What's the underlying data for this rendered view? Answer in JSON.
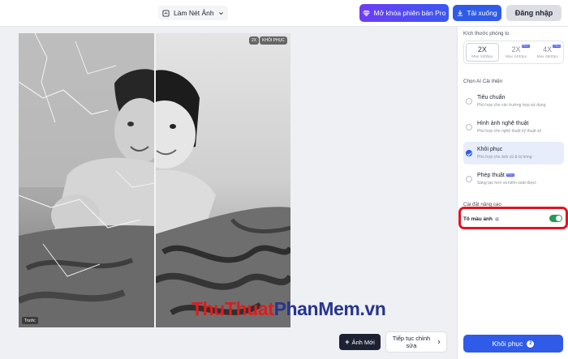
{
  "topbar": {
    "tool_label": "Làm Nét Ảnh",
    "pro_button": "Mở khóa phiên bản Pro",
    "download_button": "Tải xuống",
    "login_button": "Đăng nhập"
  },
  "image": {
    "zoom_badge": "2X",
    "mode_badge": "KHÔI PHỤC",
    "before_label": "Trước"
  },
  "watermark": {
    "part1": "Thu",
    "part2": "Thuat",
    "part3": "PhanMem",
    "part4": ".vn"
  },
  "actions": {
    "new_image": "Ảnh Mới",
    "continue_edit": "Tiếp tục chỉnh sửa"
  },
  "panel": {
    "size_title": "Kích thước phóng to",
    "sizes": [
      {
        "label": "2X",
        "sub": "Max 1600px",
        "pro": ""
      },
      {
        "label": "2X",
        "sub": "Max 2400px",
        "pro": "PRO"
      },
      {
        "label": "4X",
        "sub": "Max 3600px",
        "pro": "PRO"
      }
    ],
    "ai_title": "Chọn AI Cải thiện",
    "ai_options": [
      {
        "name": "Tiêu chuẩn",
        "desc": "Phù hợp cho các trường hợp sử dụng",
        "pro": ""
      },
      {
        "name": "Hình ảnh nghệ thuật",
        "desc": "Phù hợp cho nghệ thuật kỹ thuật số",
        "pro": ""
      },
      {
        "name": "Khôi phục",
        "desc": "Phù hợp cho ảnh cũ & bị hỏng",
        "pro": ""
      },
      {
        "name": "Phép thuật",
        "desc": "Sáng tạo hơn và kiểm soát được",
        "pro": "PRO"
      }
    ],
    "advanced_title": "Cài đặt nâng cao",
    "colorize_label": "Tô màu ảnh",
    "colorize_on": true,
    "restore_button": "Khôi phục",
    "restore_credits": "2"
  },
  "colors": {
    "accent": "#2f5be8",
    "toggle_on": "#1f9d55",
    "highlight": "#e3131f"
  }
}
